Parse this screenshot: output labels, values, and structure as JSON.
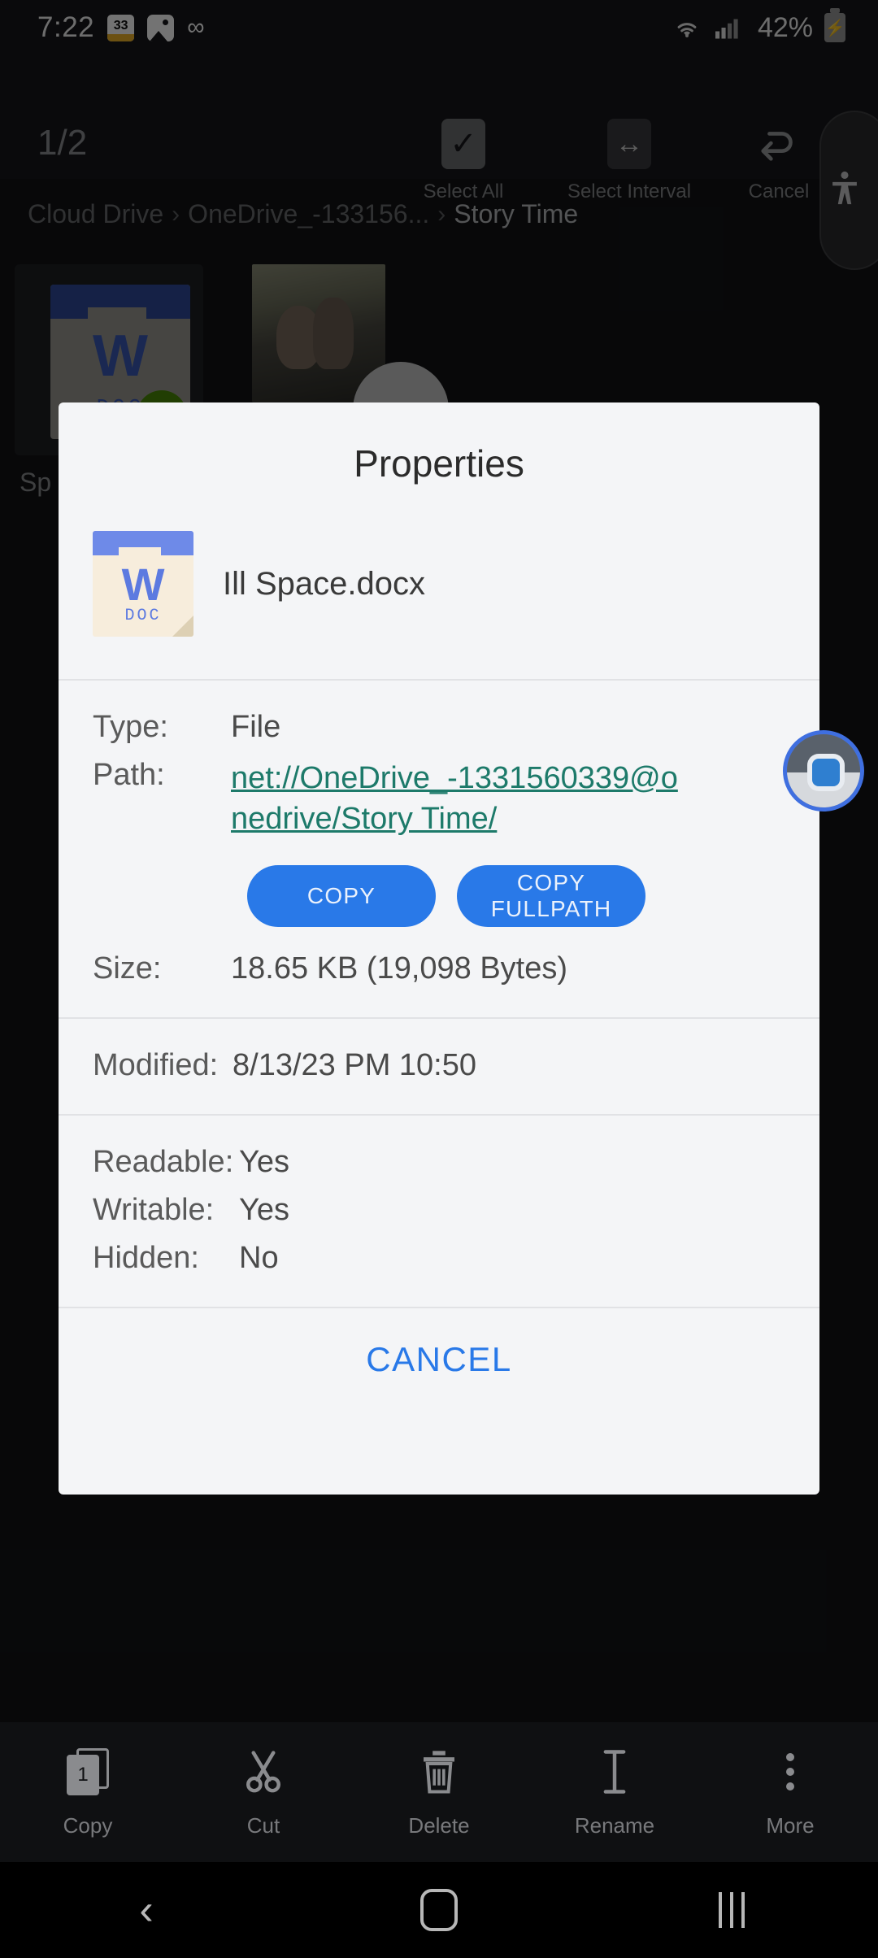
{
  "status_bar": {
    "time": "7:22",
    "notification_badge": "33",
    "icons": [
      "notification-badge-33",
      "photo-icon",
      "infinity-icon"
    ],
    "wifi": "wifi-icon",
    "signal": "signal-icon",
    "battery_percent": "42%",
    "battery": "battery-charging-icon"
  },
  "top_toolbar": {
    "page_counter": "1/2",
    "actions": [
      {
        "label": "Select All",
        "icon": "check-icon"
      },
      {
        "label": "Select Interval",
        "icon": "left-right-arrow-icon"
      },
      {
        "label": "Cancel",
        "icon": "undo-arrow-icon"
      }
    ],
    "accessibility_icon": "accessibility-person-icon"
  },
  "breadcrumb": {
    "items": [
      "Cloud Drive",
      "OneDrive_-133156...",
      "Story Time"
    ],
    "separator": "›"
  },
  "file_grid": {
    "items": [
      {
        "label": "Sp",
        "type": "docx-thumbnail",
        "selected": true,
        "badge": "✓"
      },
      {
        "label": "",
        "type": "photo-thumbnail",
        "selected": false
      }
    ],
    "doc_letter": "W",
    "doc_sub": "DOC"
  },
  "dialog": {
    "title": "Properties",
    "file_name": "Ill Space.docx",
    "file_icon_letter": "W",
    "file_icon_sub": "DOC",
    "rows": [
      {
        "label": "Type:",
        "value": "File"
      },
      {
        "label": "Path:",
        "value": "net://OneDrive_-1331560339@onedrive/Story Time/"
      },
      {
        "label": "Size:",
        "value": "18.65 KB (19,098 Bytes)"
      },
      {
        "label": "Modified:",
        "value": "8/13/23 PM 10:50"
      },
      {
        "label": "Readable:",
        "value": "Yes"
      },
      {
        "label": "Writable:",
        "value": "Yes"
      },
      {
        "label": "Hidden:",
        "value": "No"
      }
    ],
    "copy_button": "COPY",
    "copy_fullpath_button": "COPY FULLPATH",
    "cancel_button": "CANCEL",
    "link_color": "#1d7a6a",
    "accent_color": "#2979e8"
  },
  "bottom_toolbar": {
    "items": [
      {
        "label": "Copy",
        "icon": "copy-icon",
        "badge": "1"
      },
      {
        "label": "Cut",
        "icon": "scissors-icon"
      },
      {
        "label": "Delete",
        "icon": "trash-icon"
      },
      {
        "label": "Rename",
        "icon": "text-cursor-icon"
      },
      {
        "label": "More",
        "icon": "more-vertical-icon"
      }
    ]
  },
  "nav_bar": {
    "back": "back-chevron-icon",
    "home": "home-square-icon",
    "recents": "recents-lines-icon"
  },
  "floating_bubble": {
    "icon": "floating-assistant-bubble"
  }
}
